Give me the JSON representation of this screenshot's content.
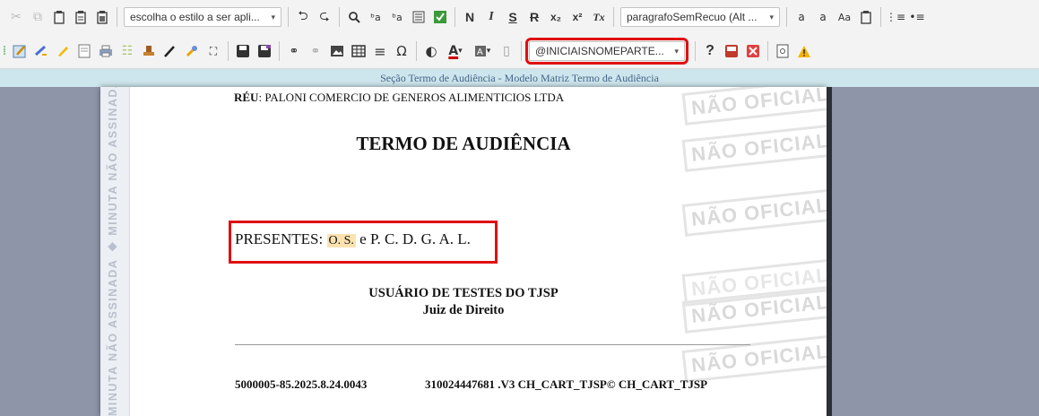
{
  "toolbar1": {
    "style_combo": "escolha o estilo a ser apli...",
    "paragraph_combo": "paragrafoSemRecuo (Alt ...",
    "bold": "N",
    "italic": "I",
    "underline": "S",
    "strike": "R",
    "subscript": "x₂",
    "superscript": "x²",
    "clear_format": "Tx",
    "font_size_small": "a",
    "font_size_mid": "a",
    "case": "Aa"
  },
  "toolbar2": {
    "mention_combo": "@INICIAISNOMEPARTE...",
    "help": "?",
    "omega": "Ω"
  },
  "section_bar": "Seção Termo de Audiência - Modelo Matriz Termo de Audiência",
  "side_strip": "MINUTA NÃO ASSINADA ◆ MINUTA NÃO ASSINADA ◆ MINUTA",
  "document": {
    "reu_label": "RÉU",
    "reu_value": ": PALONI COMERCIO DE GENEROS ALIMENTICIOS LTDA",
    "title": "TERMO DE AUDIÊNCIA",
    "presentes_label": "PRESENTES: ",
    "presentes_name1": "O. S.",
    "presentes_rest": " e P. C. D. G. A. L.",
    "signer_name": "USUÁRIO DE TESTES DO TJSP",
    "signer_role": "Juiz de Direito",
    "footer_process": "5000005-85.2025.8.24.0043",
    "footer_code": "310024447681 .V3 CH_CART_TJSP© CH_CART_TJSP"
  },
  "watermarks": [
    "NÃO OFICIAL",
    "NÃO OFICIAL",
    "NÃO OFICIAL",
    "NÃO OFICIAL",
    "NÃO OFICIAL",
    "NÃO OFICIAL"
  ],
  "colors": {
    "highlight_frame": "#e01010",
    "section_bar_bg": "#cde5ec",
    "background": "#8e95a8"
  }
}
